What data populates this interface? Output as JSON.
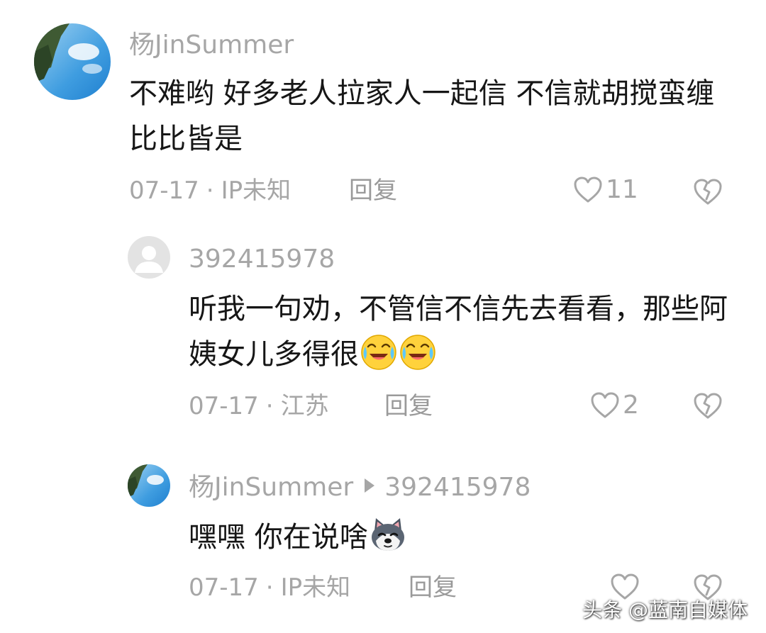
{
  "comments": [
    {
      "username": "杨JinSummer",
      "avatar_icon": "sky-tree-avatar",
      "content": "不难哟 好多老人拉家人一起信 不信就胡搅蛮缠 比比皆是",
      "date": "07-17",
      "location": "IP未知",
      "reply_label": "回复",
      "likes": "11"
    },
    {
      "username": "392415978",
      "avatar_icon": "default-user-avatar",
      "content": "听我一句劝，不管信不信先去看看，那些阿姨女儿多得很",
      "emojis": [
        "crying-laughing-emoji",
        "crying-laughing-emoji"
      ],
      "date": "07-17",
      "location": "江苏",
      "reply_label": "回复",
      "likes": "2"
    },
    {
      "username": "杨JinSummer",
      "reply_to": "392415978",
      "avatar_icon": "sky-tree-avatar",
      "content": "嘿嘿 你在说啥",
      "emojis": [
        "husky-dog-emoji"
      ],
      "date": "07-17",
      "location": "IP未知",
      "reply_label": "回复",
      "likes": ""
    }
  ],
  "separator": "·",
  "watermark": "头条 @蓝南自媒体",
  "colors": {
    "text_primary": "#161616",
    "text_secondary": "#a6a6a6",
    "background": "#ffffff"
  }
}
